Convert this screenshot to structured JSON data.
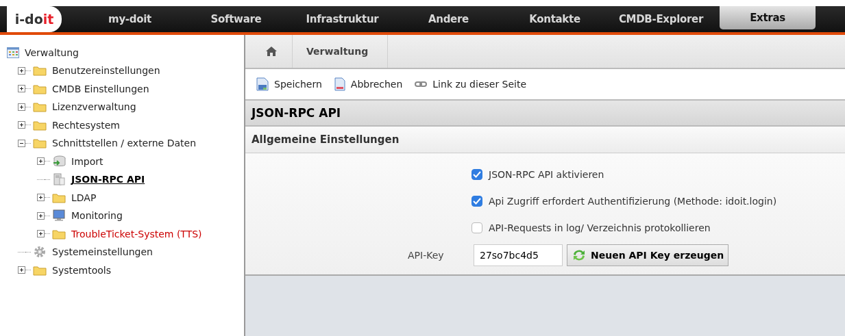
{
  "logo": {
    "text_dark": "i-do",
    "text_accent": "it"
  },
  "nav": [
    {
      "label": "my-doit",
      "selected": false
    },
    {
      "label": "Software",
      "selected": false
    },
    {
      "label": "Infrastruktur",
      "selected": false
    },
    {
      "label": "Andere",
      "selected": false
    },
    {
      "label": "Kontakte",
      "selected": false
    },
    {
      "label": "CMDB-Explorer",
      "selected": false
    },
    {
      "label": "Extras",
      "selected": true
    }
  ],
  "tree": {
    "label": "Verwaltung",
    "children": [
      {
        "label": "Benutzereinstellungen",
        "kind": "folder",
        "expanded": false,
        "selected": false,
        "color": "#222222"
      },
      {
        "label": "CMDB Einstellungen",
        "kind": "folder",
        "expanded": false,
        "selected": false,
        "color": "#222222"
      },
      {
        "label": "Lizenzverwaltung",
        "kind": "folder",
        "expanded": false,
        "selected": false,
        "color": "#222222"
      },
      {
        "label": "Rechtesystem",
        "kind": "folder",
        "expanded": false,
        "selected": false,
        "color": "#222222"
      },
      {
        "label": "Schnittstellen / externe Daten",
        "kind": "folder",
        "expanded": true,
        "selected": false,
        "color": "#222222",
        "children": [
          {
            "label": "Import",
            "kind": "import",
            "expanded": false,
            "selected": false,
            "color": "#222222"
          },
          {
            "label": "JSON-RPC API",
            "kind": "server",
            "selected": true,
            "color": "#000000"
          },
          {
            "label": "LDAP",
            "kind": "folder",
            "expanded": false,
            "selected": false,
            "color": "#222222"
          },
          {
            "label": "Monitoring",
            "kind": "monitor",
            "expanded": false,
            "selected": false,
            "color": "#222222"
          },
          {
            "label": "TroubleTicket-System (TTS)",
            "kind": "folder",
            "expanded": false,
            "selected": false,
            "color": "#cc0000"
          }
        ]
      },
      {
        "label": "Systemeinstellungen",
        "kind": "gear",
        "selected": false,
        "color": "#222222"
      },
      {
        "label": "Systemtools",
        "kind": "folder",
        "expanded": false,
        "selected": false,
        "color": "#222222"
      }
    ]
  },
  "breadcrumb": [
    "Verwaltung"
  ],
  "toolbar": [
    {
      "label": "Speichern",
      "kind": "save"
    },
    {
      "label": "Abbrechen",
      "kind": "cancel"
    },
    {
      "label": "Link zu dieser Seite",
      "kind": "link"
    }
  ],
  "title": "JSON-RPC API",
  "section": "Allgemeine Einstellungen",
  "options": [
    {
      "label": "JSON-RPC API aktivieren",
      "checked": true
    },
    {
      "label": "Api Zugriff erfordert Authentifizierung (Methode: idoit.login)",
      "checked": true
    },
    {
      "label": "API-Requests in log/ Verzeichnis protokollieren",
      "checked": false
    }
  ],
  "api_key": {
    "label": "API-Key",
    "value": "27so7bc4d5",
    "button": "Neuen API Key erzeugen"
  }
}
